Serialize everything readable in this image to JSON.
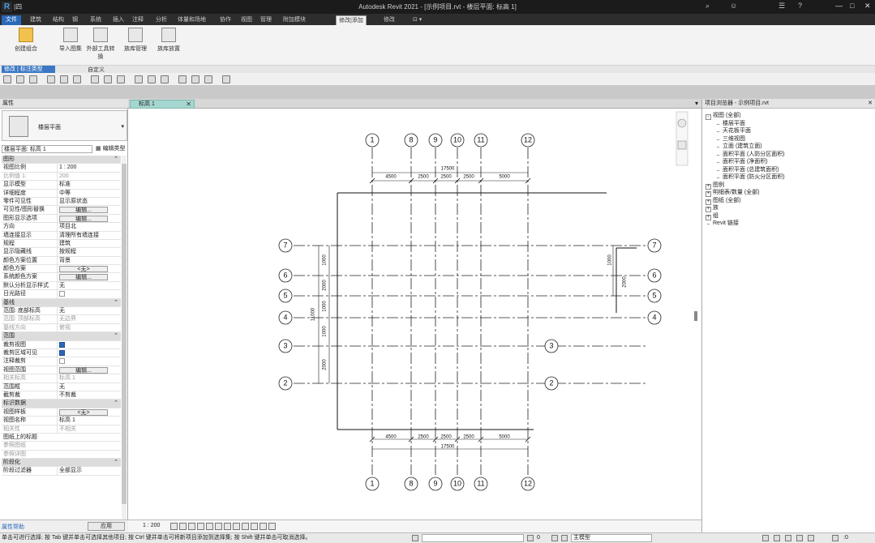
{
  "window": {
    "title": "Autodesk Revit 2021 - [示例项目.rvt - 楼层平面: 标高 1]",
    "app_logo": "R",
    "quick_access_hint": "|四"
  },
  "ribbon": {
    "tabs": [
      "文件",
      "建筑",
      "结构",
      "钢",
      "系统",
      "插入",
      "注释",
      "分析",
      "体量和场地",
      "协作",
      "视图",
      "管理",
      "附加模块",
      "修改|添加",
      "修改"
    ],
    "active_tab_index": 13,
    "buttons": [
      {
        "label": "创建组合",
        "icon": "gift-icon"
      },
      {
        "label": "导入图集",
        "icon": "import-icon"
      },
      {
        "label": "外部工具转换",
        "icon": "code-icon"
      },
      {
        "label": "族库管理",
        "icon": "family-icon"
      },
      {
        "label": "族库放置",
        "icon": "place-icon"
      }
    ],
    "panel_label": "自定义",
    "modify_dropdown": "修改 | 标注类型"
  },
  "properties": {
    "header": "属性",
    "type_name": "楼层平面",
    "filter_value": "楼层平面: 标高 1",
    "edit_type_label": "编辑类型",
    "rows": [
      {
        "k": "图形",
        "v": "",
        "kind": "sec"
      },
      {
        "k": "视图比例",
        "v": "1 : 200",
        "kind": "field"
      },
      {
        "k": "比例值 1:",
        "v": "200",
        "kind": "grey"
      },
      {
        "k": "显示模型",
        "v": "标准",
        "kind": ""
      },
      {
        "k": "详细程度",
        "v": "中等",
        "kind": ""
      },
      {
        "k": "零件可见性",
        "v": "显示原状态",
        "kind": ""
      },
      {
        "k": "可见性/图形替换",
        "v": "编辑...",
        "kind": "btn"
      },
      {
        "k": "图形显示选项",
        "v": "编辑...",
        "kind": "btn"
      },
      {
        "k": "方向",
        "v": "项目北",
        "kind": ""
      },
      {
        "k": "墙连接显示",
        "v": "清理所有墙连接",
        "kind": ""
      },
      {
        "k": "规程",
        "v": "建筑",
        "kind": ""
      },
      {
        "k": "显示隐藏线",
        "v": "按规程",
        "kind": ""
      },
      {
        "k": "颜色方案位置",
        "v": "背景",
        "kind": ""
      },
      {
        "k": "颜色方案",
        "v": "<无>",
        "kind": "btn"
      },
      {
        "k": "系统颜色方案",
        "v": "编辑...",
        "kind": "btn"
      },
      {
        "k": "默认分析显示样式",
        "v": "无",
        "kind": ""
      },
      {
        "k": "日光路径",
        "v": "",
        "kind": "cbe"
      },
      {
        "k": "基线",
        "v": "",
        "kind": "sec"
      },
      {
        "k": "范围: 底部标高",
        "v": "无",
        "kind": ""
      },
      {
        "k": "范围: 顶部标高",
        "v": "无边界",
        "kind": "grey"
      },
      {
        "k": "基线方向",
        "v": "俯视",
        "kind": "grey"
      },
      {
        "k": "范围",
        "v": "",
        "kind": "sec"
      },
      {
        "k": "裁剪视图",
        "v": "",
        "kind": "cb"
      },
      {
        "k": "裁剪区域可见",
        "v": "",
        "kind": "cb"
      },
      {
        "k": "注释裁剪",
        "v": "",
        "kind": "cbe"
      },
      {
        "k": "视图范围",
        "v": "编辑...",
        "kind": "btn"
      },
      {
        "k": "相关标高",
        "v": "标高 1",
        "kind": "grey"
      },
      {
        "k": "范围框",
        "v": "无",
        "kind": ""
      },
      {
        "k": "截剪裁",
        "v": "不剪裁",
        "kind": ""
      },
      {
        "k": "标识数据",
        "v": "",
        "kind": "sec"
      },
      {
        "k": "视图样板",
        "v": "<无>",
        "kind": "btn"
      },
      {
        "k": "视图名称",
        "v": "标高 1",
        "kind": ""
      },
      {
        "k": "相关性",
        "v": "不相关",
        "kind": "grey"
      },
      {
        "k": "图纸上的标题",
        "v": "",
        "kind": ""
      },
      {
        "k": "参照图纸",
        "v": "",
        "kind": "grey"
      },
      {
        "k": "参照详图",
        "v": "",
        "kind": "grey"
      },
      {
        "k": "阶段化",
        "v": "",
        "kind": "sec"
      },
      {
        "k": "阶段过滤器",
        "v": "全部显示",
        "kind": ""
      }
    ],
    "help_link": "属性帮助",
    "apply_label": "应用"
  },
  "view": {
    "tab_label": "标高 1",
    "scale_text": "1 : 200"
  },
  "browser": {
    "header": "项目浏览器 - 示例项目.rvt",
    "items": [
      {
        "label": "视图 (全部)",
        "level": 0,
        "tog": "-"
      },
      {
        "label": "楼层平面",
        "level": 1,
        "tog": ""
      },
      {
        "label": "天花板平面",
        "level": 1,
        "tog": ""
      },
      {
        "label": "三维视图",
        "level": 1,
        "tog": ""
      },
      {
        "label": "立面 (建筑立面)",
        "level": 1,
        "tog": ""
      },
      {
        "label": "面积平面 (人防分区面积)",
        "level": 1,
        "tog": ""
      },
      {
        "label": "面积平面 (净面积)",
        "level": 1,
        "tog": ""
      },
      {
        "label": "面积平面 (总建筑面积)",
        "level": 1,
        "tog": ""
      },
      {
        "label": "面积平面 (防火分区面积)",
        "level": 1,
        "tog": ""
      },
      {
        "label": "图例",
        "level": 0,
        "tog": "+"
      },
      {
        "label": "明细表/数量 (全部)",
        "level": 0,
        "tog": "+"
      },
      {
        "label": "图纸 (全部)",
        "level": 0,
        "tog": "+"
      },
      {
        "label": "族",
        "level": 0,
        "tog": "+"
      },
      {
        "label": "组",
        "level": 0,
        "tog": "+"
      },
      {
        "label": "Revit 链接",
        "level": 0,
        "tog": ""
      }
    ]
  },
  "drawing": {
    "top_bubbles": [
      "1",
      "8",
      "9",
      "10",
      "11",
      "12"
    ],
    "bottom_bubbles": [
      "1",
      "8",
      "9",
      "10",
      "11",
      "12"
    ],
    "left_bubbles": [
      "7",
      "6",
      "5",
      "4",
      "3",
      "2"
    ],
    "right_bubbles": [
      "7",
      "6",
      "5",
      "4",
      "3",
      "2"
    ],
    "top_dims": [
      "4500",
      "2500",
      "2500",
      "2500",
      "5000"
    ],
    "top_total": "17500",
    "bottom_dims": [
      "4500",
      "2500",
      "2500",
      "2500",
      "5000"
    ],
    "bottom_total": "17500",
    "left_dims": [
      "1000",
      "2000",
      "1000",
      "1000",
      "2000"
    ],
    "left_total": "11000",
    "right_dims": [
      "1000",
      "2000"
    ]
  },
  "status": {
    "message": "单击可进行选择; 按 Tab 键并单击可选择其他项目; 按 Ctrl 键并单击可将新项目添加到选择集; 按 Shift 键并单击可取消选择。",
    "workset": "主模型",
    "scale_field": "0"
  },
  "colors": {
    "accent": "#2a68b8",
    "view_tab": "#a5d6cf",
    "titlebar": "#1b1b1b"
  }
}
